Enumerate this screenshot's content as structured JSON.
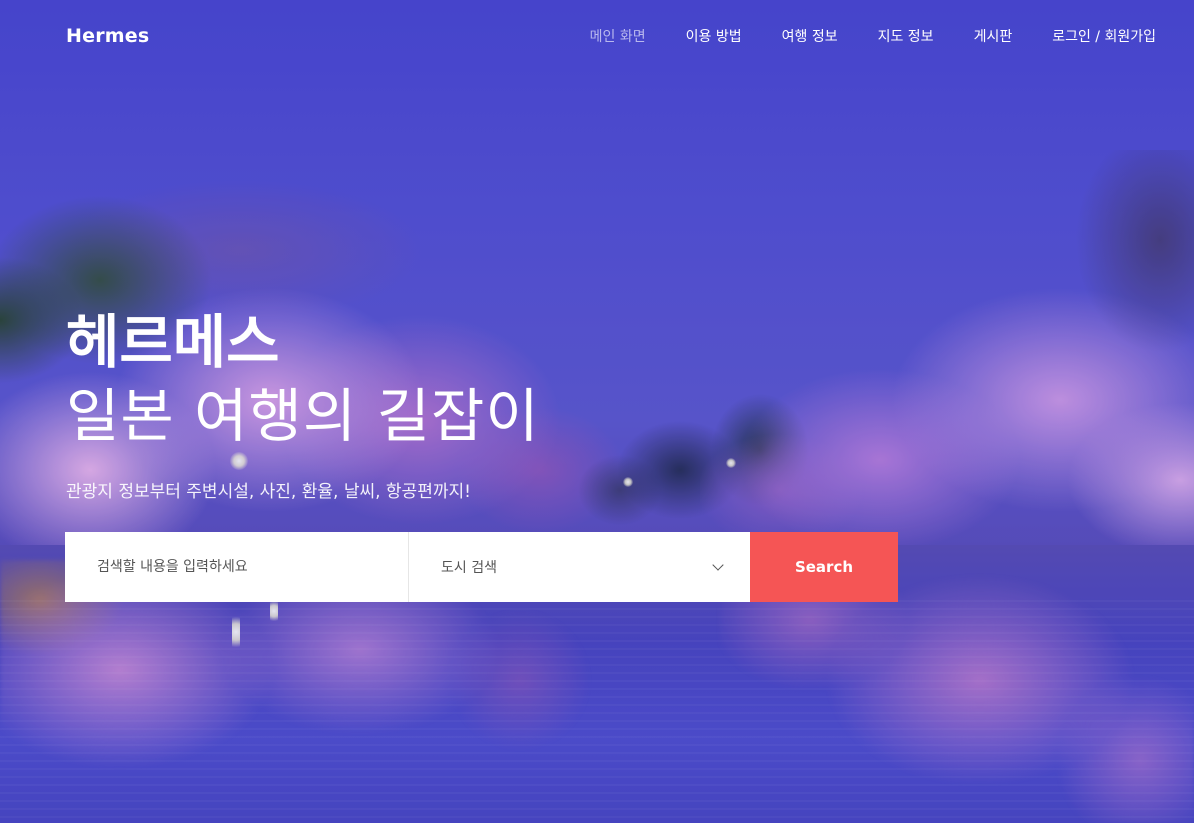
{
  "header": {
    "logo": "Hermes",
    "nav": [
      {
        "label": "메인 화면",
        "active": true
      },
      {
        "label": "이용 방법",
        "active": false
      },
      {
        "label": "여행 정보",
        "active": false
      },
      {
        "label": "지도 정보",
        "active": false
      },
      {
        "label": "게시판",
        "active": false
      },
      {
        "label": "로그인 / 회원가입",
        "active": false
      }
    ]
  },
  "hero": {
    "title": "헤르메스",
    "subtitle": "일본 여행의 길잡이",
    "description": "관광지 정보부터 주변시설, 사진, 환율, 날씨, 항공편까지!"
  },
  "search": {
    "placeholder": "검색할 내용을 입력하세요",
    "city_label": "도시 검색",
    "button_label": "Search"
  },
  "colors": {
    "sky": "#4a48d4",
    "button": "#f55555",
    "nav_active": "#b9b8ee"
  }
}
